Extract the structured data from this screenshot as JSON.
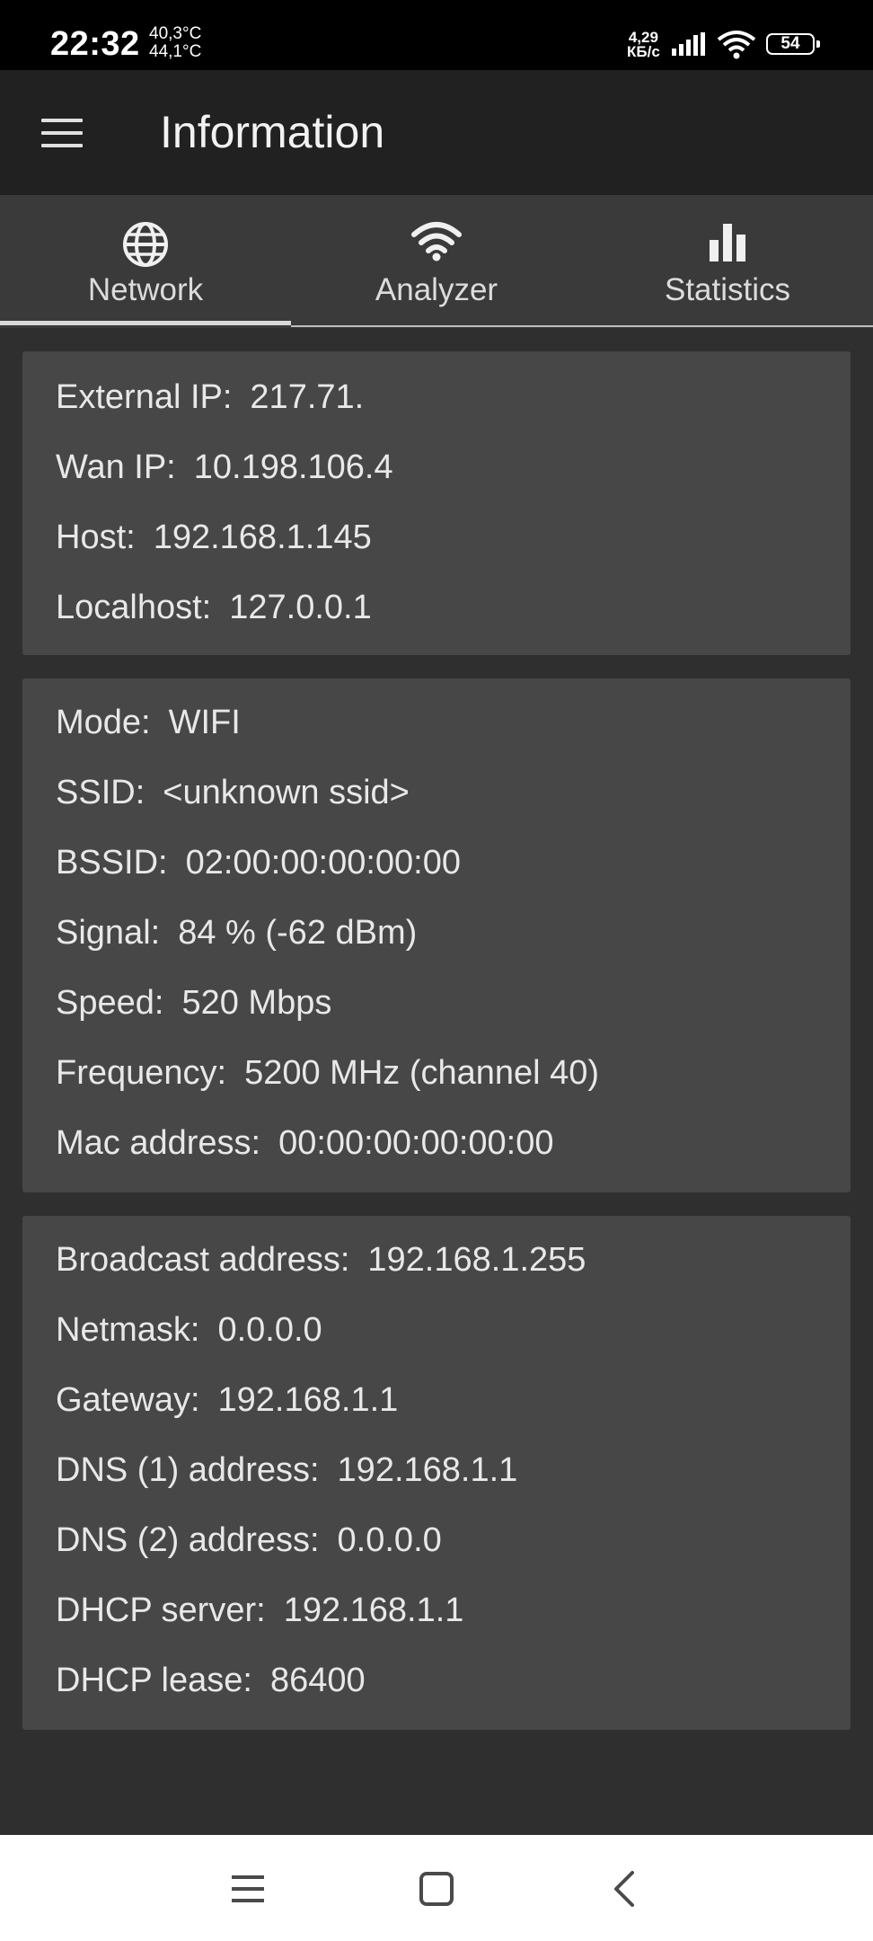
{
  "status_bar": {
    "time": "22:32",
    "temp1": "40,3°C",
    "temp2": "44,1°C",
    "speed_value": "4,29",
    "speed_unit": "КБ/с",
    "battery": "54"
  },
  "app_bar": {
    "title": "Information",
    "menu_icon": "hamburger-menu-icon"
  },
  "tabs": [
    {
      "label": "Network",
      "icon": "globe-icon",
      "selected": true
    },
    {
      "label": "Analyzer",
      "icon": "wifi-icon",
      "selected": false
    },
    {
      "label": "Statistics",
      "icon": "bar-chart-icon",
      "selected": false
    }
  ],
  "cards": {
    "ip": [
      {
        "label": "External IP:",
        "value": "217.71."
      },
      {
        "label": "Wan IP:",
        "value": "10.198.106.4"
      },
      {
        "label": "Host:",
        "value": "192.168.1.145"
      },
      {
        "label": "Localhost:",
        "value": "127.0.0.1"
      }
    ],
    "wifi": [
      {
        "label": "Mode:",
        "value": "WIFI"
      },
      {
        "label": "SSID:",
        "value": "<unknown ssid>"
      },
      {
        "label": "BSSID:",
        "value": "02:00:00:00:00:00"
      },
      {
        "label": "Signal:",
        "value": "84 % (-62 dBm)"
      },
      {
        "label": "Speed:",
        "value": "520 Mbps"
      },
      {
        "label": "Frequency:",
        "value": "5200 MHz (channel 40)"
      },
      {
        "label": "Mac address:",
        "value": "00:00:00:00:00:00"
      }
    ],
    "dhcp": [
      {
        "label": "Broadcast address:",
        "value": "192.168.1.255"
      },
      {
        "label": "Netmask:",
        "value": "0.0.0.0"
      },
      {
        "label": "Gateway:",
        "value": "192.168.1.1"
      },
      {
        "label": "DNS (1) address:",
        "value": "192.168.1.1"
      },
      {
        "label": "DNS (2) address:",
        "value": "0.0.0.0"
      },
      {
        "label": "DHCP server:",
        "value": "192.168.1.1"
      },
      {
        "label": "DHCP lease:",
        "value": "86400"
      }
    ]
  },
  "nav_bar": {
    "buttons": [
      "recents-icon",
      "home-icon",
      "back-icon"
    ]
  },
  "colors": {
    "background": "#2f2f2f",
    "app_bar": "#212121",
    "tab_bar": "#3a3a3a",
    "card": "#474747",
    "text": "#e8e8e8"
  }
}
